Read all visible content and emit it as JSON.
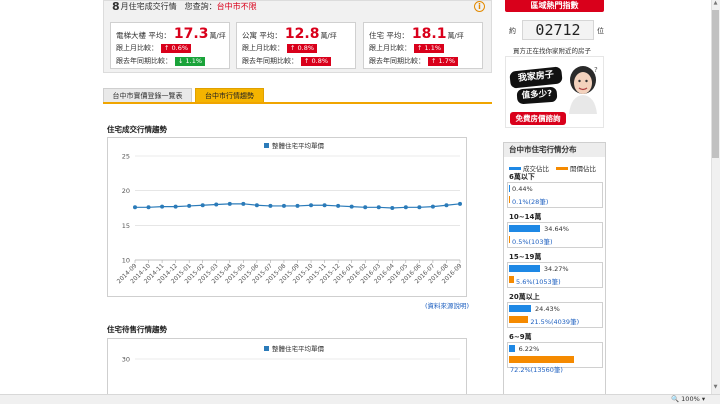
{
  "summary": {
    "month_num": "8",
    "month_suffix": "月住宅成交行情",
    "region_label": "您查詢：",
    "region_value": "台中市不限",
    "info_icon": "i"
  },
  "cards": [
    {
      "type": "電梯大樓",
      "avg_label": "平均：",
      "price": "17.3",
      "unit": "萬/坪",
      "mom_label": "跟上月比較：",
      "mom": "↑ 0.6%",
      "mom_dir": "up",
      "yoy_label": "跟去年同期比較：",
      "yoy": "↓ 1.1%",
      "yoy_dir": "down"
    },
    {
      "type": "公寓",
      "avg_label": "平均：",
      "price": "12.8",
      "unit": "萬/坪",
      "mom_label": "跟上月比較：",
      "mom": "↑ 0.8%",
      "mom_dir": "up",
      "yoy_label": "跟去年同期比較：",
      "yoy": "↑ 0.8%",
      "yoy_dir": "up"
    },
    {
      "type": "住宅",
      "avg_label": "平均：",
      "price": "18.1",
      "unit": "萬/坪",
      "mom_label": "跟上月比較：",
      "mom": "↑ 1.1%",
      "mom_dir": "up",
      "yoy_label": "跟去年同期比較：",
      "yoy": "↑ 1.7%",
      "yoy_dir": "up"
    }
  ],
  "tabs": [
    {
      "label": "台中市實價登錄一覽表",
      "active": false
    },
    {
      "label": "台中市行情趨勢",
      "active": true
    }
  ],
  "sections": {
    "trend_title": "住宅成交行情趨勢",
    "source_link": "(資料來源說明)",
    "sale_title": "住宅待售行情趨勢"
  },
  "chart_data": [
    {
      "type": "line",
      "title": "",
      "legend": "整體住宅平均單價",
      "legend_position": "top",
      "grid": true,
      "x": [
        "2014-09",
        "2014-10",
        "2014-11",
        "2014-12",
        "2015-01",
        "2015-02",
        "2015-03",
        "2015-04",
        "2015-05",
        "2015-06",
        "2015-07",
        "2015-08",
        "2015-09",
        "2015-10",
        "2015-11",
        "2015-12",
        "2016-01",
        "2016-02",
        "2016-03",
        "2016-04",
        "2016-05",
        "2016-06",
        "2016-07",
        "2016-08",
        "2016-09"
      ],
      "series": [
        {
          "name": "整體住宅平均單價",
          "values": [
            17.6,
            17.6,
            17.7,
            17.7,
            17.8,
            17.9,
            18.0,
            18.1,
            18.1,
            17.9,
            17.8,
            17.8,
            17.8,
            17.9,
            17.9,
            17.8,
            17.7,
            17.6,
            17.6,
            17.5,
            17.6,
            17.6,
            17.7,
            17.9,
            18.1
          ]
        }
      ],
      "yticks": [
        10,
        15,
        20,
        25
      ],
      "ylim": [
        10,
        25
      ],
      "color": "#2b7bb9"
    },
    {
      "type": "line",
      "title": "",
      "legend": "整體住宅平均單價",
      "legend_position": "top",
      "grid": true,
      "x": [],
      "series": [],
      "yticks": [
        30
      ],
      "ylim": [
        null,
        30
      ],
      "color": "#2b7bb9"
    }
  ],
  "right": {
    "hot_button": "區域熱門指數",
    "counter_pre": "約",
    "counter": "02712",
    "counter_post": "位",
    "counter_line": "買方正在找你家附近的房子",
    "ad_line1": "我家房子",
    "ad_line2": "值多少?",
    "ad_button": "免費房價諮詢",
    "dist_title": "台中市住宅行情分布",
    "legend_deal": "成交佔比",
    "legend_listing": "開價佔比",
    "groups": [
      {
        "label": "6萬以下",
        "deal_pct": 0.44,
        "deal_text": "0.44%",
        "list_pct": 0.1,
        "list_text": "0.1%(28筆)"
      },
      {
        "label": "10~14萬",
        "deal_pct": 34.64,
        "deal_text": "34.64%",
        "list_pct": 0.5,
        "list_text": "0.5%(103筆)"
      },
      {
        "label": "15~19萬",
        "deal_pct": 34.27,
        "deal_text": "34.27%",
        "list_pct": 5.6,
        "list_text": "5.6%(1053筆)"
      },
      {
        "label": "20萬以上",
        "deal_pct": 24.43,
        "deal_text": "24.43%",
        "list_pct": 21.5,
        "list_text": "21.5%(4039筆)"
      },
      {
        "label": "6~9萬",
        "deal_pct": 6.22,
        "deal_text": "6.22%",
        "list_pct": 72.2,
        "list_text": "72.2%(13560筆)"
      }
    ]
  },
  "status": {
    "zoom": "100%"
  },
  "colors": {
    "accent_red": "#d9001b",
    "tab_active": "#f5b400",
    "deal_blue": "#1e88e5",
    "listing_orange": "#f58a00",
    "down_green": "#1aa33a"
  }
}
